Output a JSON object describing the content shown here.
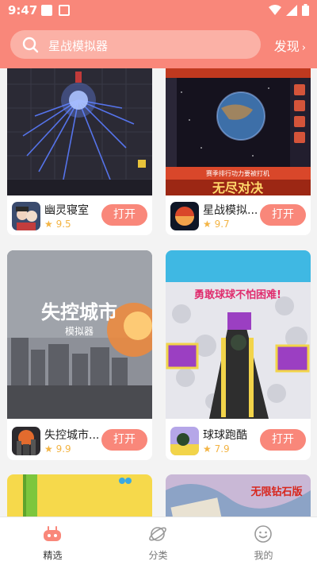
{
  "status_bar": {
    "time": "9:47"
  },
  "search": {
    "placeholder": "星战模拟器"
  },
  "header": {
    "discover_label": "发现",
    "discover_arrow": "›"
  },
  "accent_color": "#f9877a",
  "games": [
    {
      "name": "幽灵寝室",
      "rating": "9.5",
      "button": "打开"
    },
    {
      "name": "星战模拟...",
      "rating": "9.7",
      "button": "打开",
      "thumb_banner": "赛季排行功力要被打机",
      "thumb_banner2": "无尽对决"
    },
    {
      "name": "失控城市...",
      "rating": "9.9",
      "button": "打开",
      "thumb_title": "失控城市",
      "thumb_subtitle": "模拟器"
    },
    {
      "name": "球球跑酷",
      "rating": "7.9",
      "button": "打开",
      "thumb_title": "勇敢球球不怕困难!"
    },
    {
      "thumb_title": "无限钻石版"
    }
  ],
  "tabs": [
    {
      "label": "精选",
      "icon": "gamepad-icon"
    },
    {
      "label": "分类",
      "icon": "planet-icon"
    },
    {
      "label": "我的",
      "icon": "smiley-icon"
    }
  ]
}
